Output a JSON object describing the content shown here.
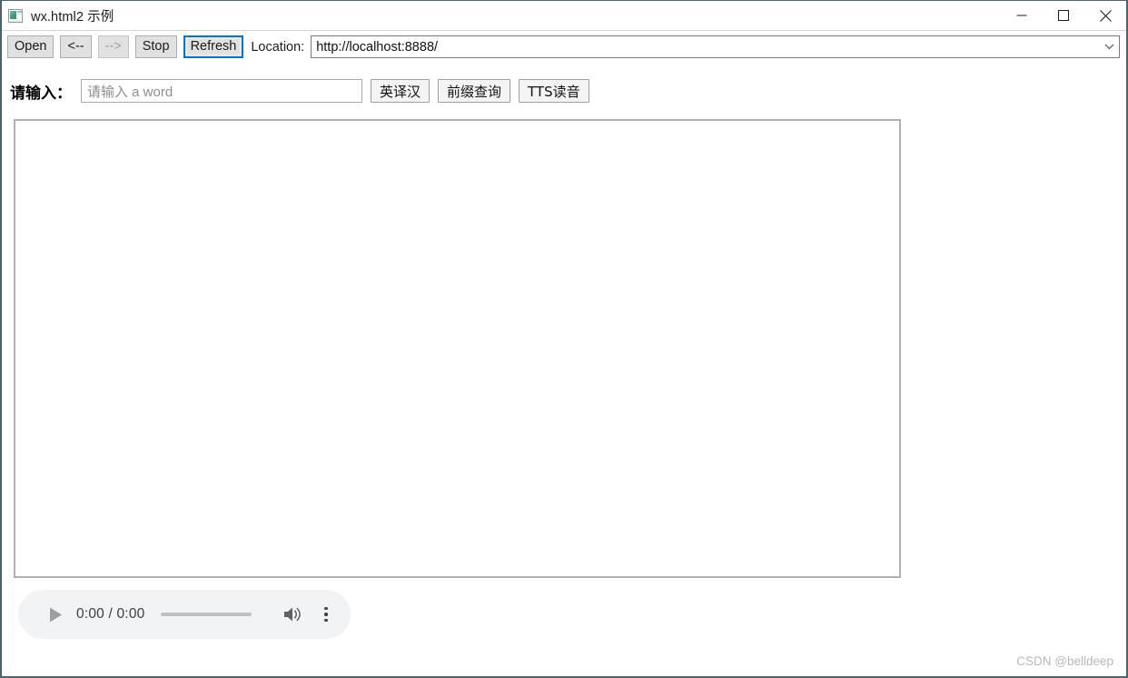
{
  "window": {
    "title": "wx.html2 示例",
    "icon": "app-window-icon",
    "controls": {
      "minimize": "minimize-icon",
      "maximize": "maximize-icon",
      "close": "close-icon"
    }
  },
  "toolbar": {
    "open_label": "Open",
    "back_label": "<--",
    "forward_label": "-->",
    "stop_label": "Stop",
    "refresh_label": "Refresh",
    "location_label": "Location:",
    "location_value": "http://localhost:8888/",
    "dropdown_icon": "chevron-down-icon",
    "focused_button": "Refresh",
    "disabled_button": "-->",
    "focus_color": "#0078d7"
  },
  "query": {
    "label": "请输入：",
    "input_placeholder": "请输入 a word",
    "input_value": "",
    "buttons": [
      {
        "label": "英译汉"
      },
      {
        "label": "前缀查询"
      },
      {
        "label": "TTS读音"
      }
    ]
  },
  "content": {
    "html": ""
  },
  "audio": {
    "play_icon": "play-icon",
    "time": "0:00 / 0:00",
    "current_time": "0:00",
    "duration": "0:00",
    "progress_percent": 0,
    "volume_icon": "volume-icon",
    "more_icon": "more-vertical-icon",
    "background_color": "#f1f3f4"
  },
  "watermark": {
    "text": "CSDN @belldeep"
  }
}
